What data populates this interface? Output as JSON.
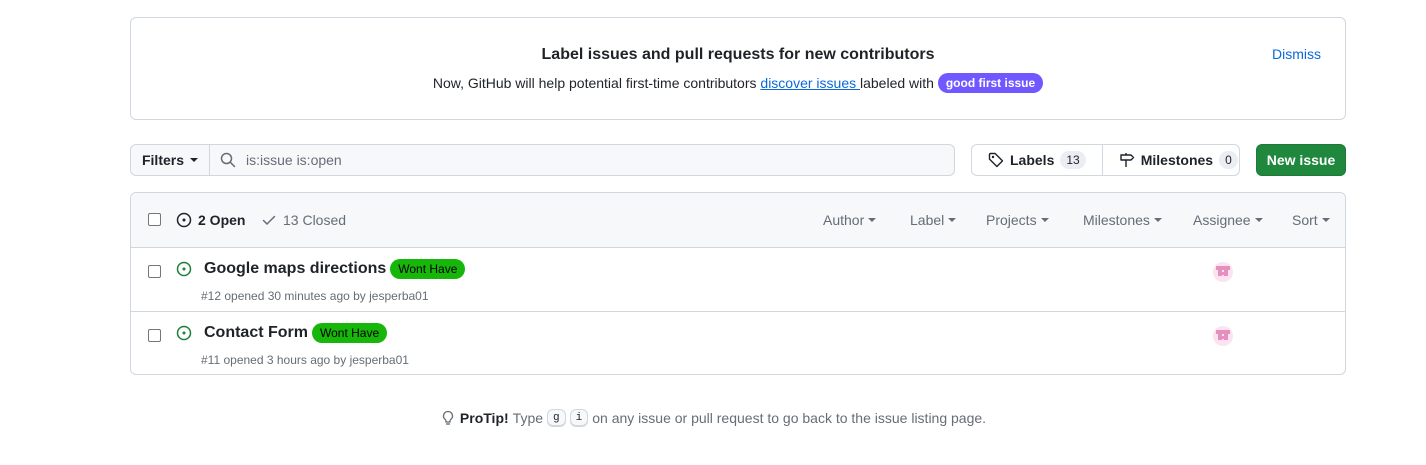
{
  "banner": {
    "title": "Label issues and pull requests for new contributors",
    "text_before": "Now, GitHub will help potential first-time contributors ",
    "link": "discover issues ",
    "text_after": "labeled with ",
    "badge": "good first issue",
    "dismiss": "Dismiss"
  },
  "toolbar": {
    "filters_label": "Filters",
    "search_value": "is:issue is:open",
    "labels_label": "Labels",
    "labels_count": "13",
    "milestones_label": "Milestones",
    "milestones_count": "0",
    "new_issue_label": "New issue"
  },
  "header": {
    "open_label": "2 Open",
    "closed_label": "13 Closed",
    "filters": [
      "Author",
      "Label",
      "Projects",
      "Milestones",
      "Assignee",
      "Sort"
    ]
  },
  "issues": [
    {
      "title": "Google maps directions",
      "label": "Wont Have",
      "meta": "#12 opened 30 minutes ago by jesperba01"
    },
    {
      "title": "Contact Form",
      "label": "Wont Have",
      "meta": "#11 opened 3 hours ago by jesperba01"
    }
  ],
  "protip": {
    "bold": "ProTip!",
    "type_word": "Type",
    "key1": "g",
    "key2": "i",
    "rest": "on any issue or pull request to go back to the issue listing page."
  },
  "colors": {
    "primary_button": "#1f883d",
    "good_first_issue": "#7057ff",
    "wont_have": "#17b60b",
    "link": "#0969da",
    "open_icon": "#1a7f37"
  }
}
